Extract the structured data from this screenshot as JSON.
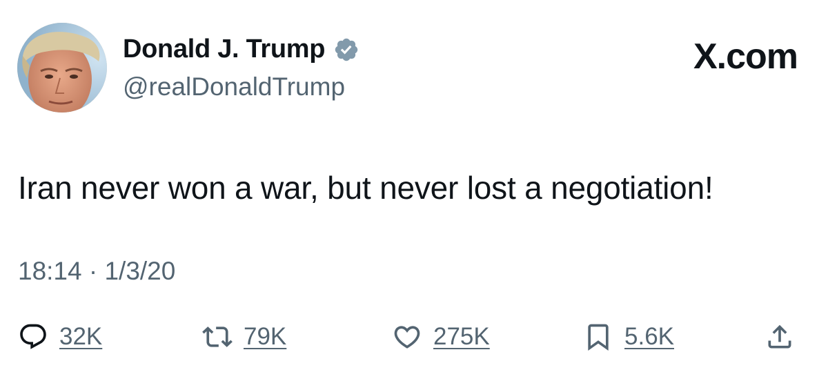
{
  "header": {
    "display_name": "Donald J. Trump",
    "handle": "@realDonaldTrump",
    "verified_icon": "verified-badge-icon",
    "brand": "X.com"
  },
  "tweet": {
    "text": "Iran never won a war, but never lost a negotiation!",
    "timestamp": "18:14 · 1/3/20"
  },
  "actions": {
    "reply": {
      "icon": "reply-icon",
      "count": "32K"
    },
    "repost": {
      "icon": "repost-icon",
      "count": "79K"
    },
    "like": {
      "icon": "heart-icon",
      "count": "275K"
    },
    "bookmark": {
      "icon": "bookmark-icon",
      "count": "5.6K"
    },
    "share": {
      "icon": "share-icon"
    }
  },
  "colors": {
    "text_primary": "#0f1419",
    "text_secondary": "#536471",
    "verified_badge": "#829aab",
    "background": "#ffffff"
  }
}
